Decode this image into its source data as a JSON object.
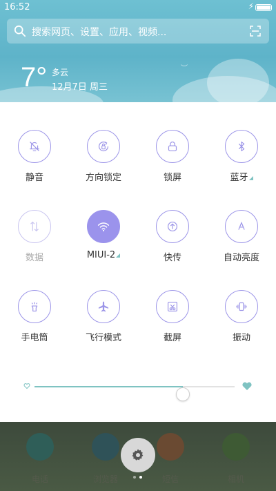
{
  "status_bar": {
    "time": "16:52",
    "charging": true
  },
  "search": {
    "placeholder": "搜索网页、设置、应用、视频..."
  },
  "weather": {
    "temperature": "7°",
    "condition": "多云",
    "date": "12月7日 周三"
  },
  "toggles": [
    {
      "label": "静音",
      "icon": "bell-off-icon",
      "state": "off"
    },
    {
      "label": "方向锁定",
      "icon": "rotation-lock-icon",
      "state": "off"
    },
    {
      "label": "锁屏",
      "icon": "lock-icon",
      "state": "off"
    },
    {
      "label": "蓝牙",
      "icon": "bluetooth-icon",
      "state": "off",
      "has_menu": true
    },
    {
      "label": "数据",
      "icon": "mobile-data-icon",
      "state": "disabled"
    },
    {
      "label": "MIUI-2",
      "icon": "wifi-icon",
      "state": "on",
      "has_menu": true
    },
    {
      "label": "快传",
      "icon": "quick-transfer-icon",
      "state": "off"
    },
    {
      "label": "自动亮度",
      "icon": "auto-brightness-icon",
      "state": "off"
    },
    {
      "label": "手电筒",
      "icon": "flashlight-icon",
      "state": "off"
    },
    {
      "label": "飞行模式",
      "icon": "airplane-icon",
      "state": "off"
    },
    {
      "label": "截屏",
      "icon": "screenshot-icon",
      "state": "off"
    },
    {
      "label": "振动",
      "icon": "vibrate-icon",
      "state": "off"
    }
  ],
  "brightness": {
    "level": 0.74
  },
  "dock": {
    "apps": [
      {
        "label": "电话",
        "icon": "phone-icon"
      },
      {
        "label": "浏览器",
        "icon": "browser-icon"
      },
      {
        "label": "短信",
        "icon": "messages-icon"
      },
      {
        "label": "相机",
        "icon": "camera-icon"
      }
    ]
  },
  "page_indicator": {
    "pages": 2,
    "current": 2
  },
  "colors": {
    "accent": "#9b93ec",
    "teal": "#7fc3c2",
    "sky": "#5eb3c9"
  }
}
